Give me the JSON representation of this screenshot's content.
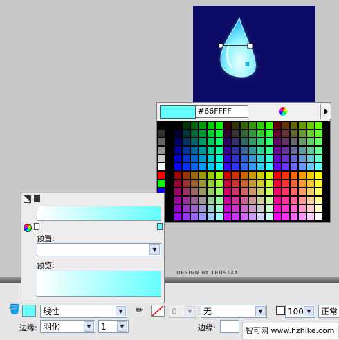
{
  "swatch": {
    "hex_value": "#66FFFF",
    "preview_color": "#66FFFF"
  },
  "gradient_panel": {
    "preset_label": "预置:",
    "preview_label": "预览:",
    "start_color": "#FFFFFF",
    "end_color": "#66FFFF"
  },
  "canvas": {
    "design_by": "DESIGN BY TRUSTXX"
  },
  "toolbar": {
    "fill_type": "线性",
    "stroke_width_value": "0",
    "stroke_style": "无",
    "opacity_value": "100",
    "blend_mode": "正常",
    "edge_label_left": "边缘:",
    "edge_type": "羽化",
    "edge_amount": "1",
    "edge_label_right": "边缘:"
  },
  "watermark": {
    "text": "智可网 www.hzhike.com"
  }
}
